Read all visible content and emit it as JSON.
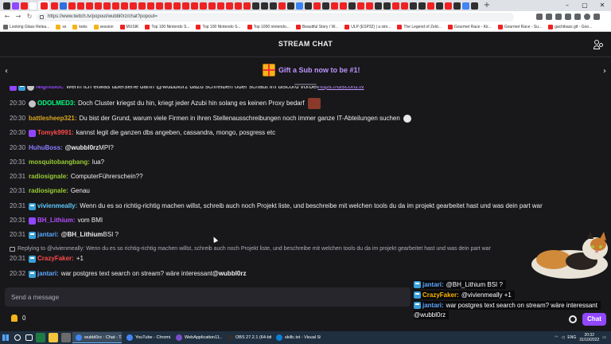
{
  "browser": {
    "url": "https://www.twitch.tv/popout/wubbl0rz/chat?popout=",
    "bookmarks": [
      "Looking Glass Relea...",
      "ss",
      "keks",
      "session",
      "MUSIK",
      "Top 100 Nintendo S...",
      "Top 100 Nintendo S...",
      "Top 1000 nintendo...",
      "Beautiful Story / W...",
      "ULP (ESP32) | a sim...",
      "The Legend of Zeld...",
      "Gourmet Race - Kir...",
      "Gourmet Race - Su...",
      "gachibass gif - Goo..."
    ]
  },
  "header": {
    "title": "STREAM CHAT"
  },
  "banner": {
    "text": "Gift a Sub now to be #1!"
  },
  "messages": [
    {
      "time": "",
      "user": "Nightbot:",
      "user_color": "#9146ff",
      "text": " wenn ich etwas übersehe dann @wubbl0rz dazu schreiben oder schaut im discord vorbei ",
      "link": "https://discord.tv"
    },
    {
      "time": "20:30",
      "user": "ODOLMED3:",
      "user_color": "#00ff7f",
      "text": " Doch Cluster kriegst du hin, kriegt jeder Azubi hin solang es keinen Proxy bedarf"
    },
    {
      "time": "20:30",
      "user": "battlesheep321:",
      "user_color": "#daa520",
      "text": " Du bist der Grund, warum viele Firmen in ihren Stellenausschreibungen noch immer ganze IT-Abteilungen suchen"
    },
    {
      "time": "20:30",
      "user": "Tomyk9991:",
      "user_color": "#ff4a4a",
      "text": " kannst legit die ganzen dbs angeben, cassandra, mongo, posgress etc"
    },
    {
      "time": "20:30",
      "user": "HuhuBoss:",
      "user_color": "#8a7dff",
      "text": " ",
      "mention": "@wubbl0rz",
      "rest": " MPI?"
    },
    {
      "time": "20:31",
      "user": "mosquitobangbang:",
      "user_color": "#9acd32",
      "text": " lua?"
    },
    {
      "time": "20:31",
      "user": "radiosignale:",
      "user_color": "#9acd32",
      "text": " ComputerFührerschein??"
    },
    {
      "time": "20:31",
      "user": "radiosignale:",
      "user_color": "#9acd32",
      "text": " Genau"
    },
    {
      "time": "20:31",
      "user": "vivienmeally:",
      "user_color": "#5fc9f8",
      "text": " Wenn du es so richtig-richtig machen willst, schreib auch noch Projekt liste, und beschreibe mit welchen tools du da im projekt gearbeitet hast und was dein part war"
    },
    {
      "time": "20:31",
      "user": "BH_Lithium:",
      "user_color": "#b64dff",
      "text": " vom BMI"
    },
    {
      "time": "20:31",
      "user": "jantari:",
      "user_color": "#5fa8ff",
      "text": " ",
      "mention": "@BH_Lithium",
      "rest": " BSI ?"
    },
    {
      "time": "20:31",
      "user": "CrazyFaker:",
      "user_color": "#ff4a4a",
      "text": " +1"
    },
    {
      "time": "20:32",
      "user": "jantari:",
      "user_color": "#5fa8ff",
      "text": " war postgres text search on stream? wäre interessant ",
      "mention": "@wubbl0rz"
    }
  ],
  "reply": {
    "text": "Replying to @vivienmeally: Wenn du es so richtig-richtig machen willst, schreib auch noch Projekt liste, und beschreibe mit welchen tools du da im projekt gearbeitet hast und was dein part war"
  },
  "composer": {
    "placeholder": "Send a message"
  },
  "points": {
    "value": "0"
  },
  "chat_button": {
    "label": "Chat"
  },
  "overlay": [
    {
      "user": "jantari:",
      "user_color": "#5fa8ff",
      "text": " @BH_Lithium BSI ?"
    },
    {
      "user": "CrazyFaker:",
      "user_color": "#ffb400",
      "text": " @vivienmeally +1"
    },
    {
      "user": "jantari:",
      "user_color": "#5fa8ff",
      "text": " war postgres text search on stream? wäre interessant"
    },
    {
      "user": "",
      "user_color": "#fff",
      "text": "@wubbl0rz"
    }
  ],
  "taskbar": {
    "apps": [
      {
        "label": "wubbl0rz - Chat - T...",
        "color": "#4285f4",
        "active": true
      },
      {
        "label": "YouTube - Chromi...",
        "color": "#4285f4",
        "active": false
      },
      {
        "label": "WebApplication11...",
        "color": "#7a4dc9",
        "active": false
      },
      {
        "label": "OBS 27.2.1 (64-bit, ...",
        "color": "#302e31",
        "active": false
      },
      {
        "label": "skillc.txt - Visual St...",
        "color": "#0a7fd4",
        "active": false
      }
    ],
    "lang": "ENG",
    "time": "20:32",
    "date": "31/10/2022"
  }
}
